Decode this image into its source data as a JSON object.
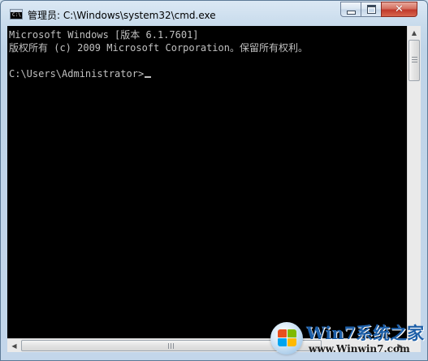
{
  "window": {
    "title": "管理员: C:\\Windows\\system32\\cmd.exe",
    "icon": "cmd-icon",
    "icon_prompt": "C:\\",
    "controls": {
      "minimize": "minimize-icon",
      "maximize": "maximize-icon",
      "close": "close-icon"
    },
    "close_glyph": "✕"
  },
  "console": {
    "lines": [
      "Microsoft Windows [版本 6.1.7601]",
      "版权所有 (c) 2009 Microsoft Corporation。保留所有权利。",
      "",
      "C:\\Users\\Administrator>"
    ],
    "background": "#000000",
    "foreground": "#c0c0c0"
  },
  "scrollbars": {
    "up_arrow": "▲",
    "down_arrow": "▼",
    "left_arrow": "◀",
    "right_arrow": "▶"
  },
  "watermark": {
    "brand": "Win7系统之家",
    "url": "www.Winwin7.com"
  },
  "colors": {
    "frame": "#c3d6ea",
    "close_button": "#c0392b",
    "brand": "#1d5fa8"
  }
}
